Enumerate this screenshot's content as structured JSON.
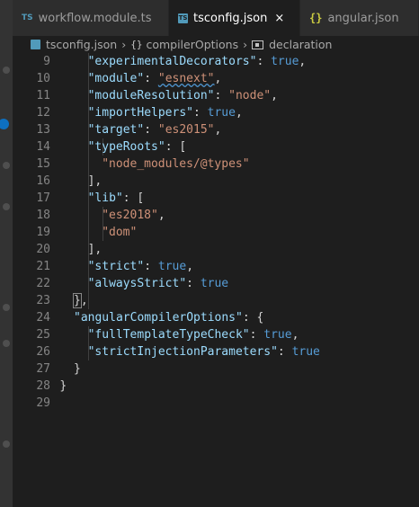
{
  "tabs": [
    {
      "badge": "TS",
      "label": "workflow.module.ts"
    },
    {
      "badge": "TS",
      "label": "tsconfig.json",
      "close": "×"
    },
    {
      "badge": "{}",
      "label": "angular.json"
    }
  ],
  "breadcrumb": {
    "file": "tsconfig.json",
    "obj_glyph": "{}",
    "section": "compilerOptions",
    "leaf": "declaration"
  },
  "code_lines": [
    {
      "n": "9",
      "indent": 2,
      "tokens": [
        {
          "t": "k",
          "v": "\"experimentalDecorators\""
        },
        {
          "t": "p",
          "v": ": "
        },
        {
          "t": "b",
          "v": "true"
        },
        {
          "t": "p",
          "v": ","
        }
      ]
    },
    {
      "n": "10",
      "indent": 2,
      "tokens": [
        {
          "t": "k",
          "v": "\"module\""
        },
        {
          "t": "p",
          "v": ": "
        },
        {
          "t": "s",
          "v": "\"esnext\"",
          "sq": true
        },
        {
          "t": "p",
          "v": ","
        }
      ]
    },
    {
      "n": "11",
      "indent": 2,
      "tokens": [
        {
          "t": "k",
          "v": "\"moduleResolution\""
        },
        {
          "t": "p",
          "v": ": "
        },
        {
          "t": "s",
          "v": "\"node\""
        },
        {
          "t": "p",
          "v": ","
        }
      ]
    },
    {
      "n": "12",
      "indent": 2,
      "tokens": [
        {
          "t": "k",
          "v": "\"importHelpers\""
        },
        {
          "t": "p",
          "v": ": "
        },
        {
          "t": "b",
          "v": "true"
        },
        {
          "t": "p",
          "v": ","
        }
      ]
    },
    {
      "n": "13",
      "indent": 2,
      "tokens": [
        {
          "t": "k",
          "v": "\"target\""
        },
        {
          "t": "p",
          "v": ": "
        },
        {
          "t": "s",
          "v": "\"es2015\""
        },
        {
          "t": "p",
          "v": ","
        }
      ]
    },
    {
      "n": "14",
      "indent": 2,
      "tokens": [
        {
          "t": "k",
          "v": "\"typeRoots\""
        },
        {
          "t": "p",
          "v": ": ["
        }
      ]
    },
    {
      "n": "15",
      "indent": 3,
      "tokens": [
        {
          "t": "s",
          "v": "\"node_modules/@types\""
        }
      ]
    },
    {
      "n": "16",
      "indent": 2,
      "tokens": [
        {
          "t": "p",
          "v": "],"
        }
      ]
    },
    {
      "n": "17",
      "indent": 2,
      "tokens": [
        {
          "t": "k",
          "v": "\"lib\""
        },
        {
          "t": "p",
          "v": ": ["
        }
      ]
    },
    {
      "n": "18",
      "indent": 3,
      "tokens": [
        {
          "t": "s",
          "v": "\"es2018\""
        },
        {
          "t": "p",
          "v": ","
        }
      ]
    },
    {
      "n": "19",
      "indent": 3,
      "tokens": [
        {
          "t": "s",
          "v": "\"dom\""
        }
      ]
    },
    {
      "n": "20",
      "indent": 2,
      "tokens": [
        {
          "t": "p",
          "v": "],"
        }
      ]
    },
    {
      "n": "21",
      "indent": 2,
      "tokens": [
        {
          "t": "k",
          "v": "\"strict\""
        },
        {
          "t": "p",
          "v": ": "
        },
        {
          "t": "b",
          "v": "true"
        },
        {
          "t": "p",
          "v": ","
        }
      ]
    },
    {
      "n": "22",
      "indent": 2,
      "tokens": [
        {
          "t": "k",
          "v": "\"alwaysStrict\""
        },
        {
          "t": "p",
          "v": ": "
        },
        {
          "t": "b",
          "v": "true"
        }
      ]
    },
    {
      "n": "23",
      "indent": 1,
      "tokens": [
        {
          "t": "p",
          "v": "}",
          "hl": true
        },
        {
          "t": "p",
          "v": ","
        }
      ]
    },
    {
      "n": "24",
      "indent": 1,
      "tokens": [
        {
          "t": "k",
          "v": "\"angularCompilerOptions\""
        },
        {
          "t": "p",
          "v": ": {"
        }
      ]
    },
    {
      "n": "25",
      "indent": 2,
      "tokens": [
        {
          "t": "k",
          "v": "\"fullTemplateTypeCheck\""
        },
        {
          "t": "p",
          "v": ": "
        },
        {
          "t": "b",
          "v": "true"
        },
        {
          "t": "p",
          "v": ","
        }
      ]
    },
    {
      "n": "26",
      "indent": 2,
      "tokens": [
        {
          "t": "k",
          "v": "\"strictInjectionParameters\""
        },
        {
          "t": "p",
          "v": ": "
        },
        {
          "t": "b",
          "v": "true"
        }
      ]
    },
    {
      "n": "27",
      "indent": 1,
      "tokens": [
        {
          "t": "p",
          "v": "}"
        }
      ]
    },
    {
      "n": "28",
      "indent": 0,
      "tokens": [
        {
          "t": "p",
          "v": "}"
        }
      ]
    },
    {
      "n": "29",
      "indent": 0,
      "tokens": []
    }
  ],
  "colors": {
    "editor_bg": "#1e1e1e",
    "key": "#9cdcfe",
    "string": "#ce9178",
    "boolean": "#569cd6",
    "punctuation": "#d4d4d4",
    "line_number": "#858585"
  }
}
